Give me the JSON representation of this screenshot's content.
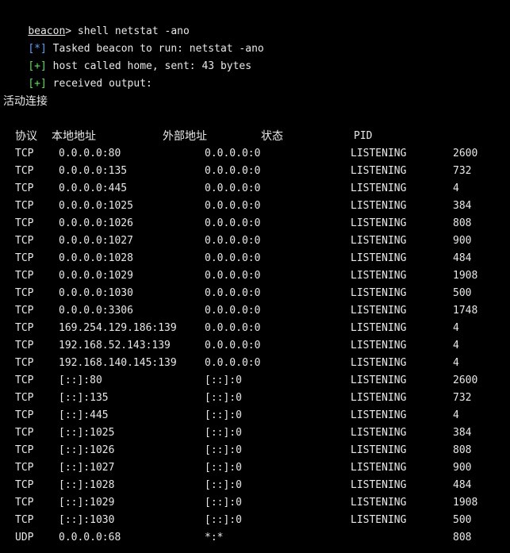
{
  "console": {
    "prompt_name": "beacon",
    "prompt_symbol": ">",
    "command": " shell netstat -ano",
    "messages": [
      {
        "tag": "[*]",
        "text": " Tasked beacon to run: netstat -ano",
        "kind": "info"
      },
      {
        "tag": "[+]",
        "text": " host called home, sent: 43 bytes",
        "kind": "ok"
      },
      {
        "tag": "[+]",
        "text": " received output:",
        "kind": "ok"
      }
    ],
    "colors": {
      "background": "#000000",
      "text": "#e8e8e8",
      "info_tag": "#57a5ff",
      "ok_tag": "#59e359"
    }
  },
  "netstat": {
    "title": "活动连接",
    "headers": {
      "proto": "协议",
      "local": "本地地址",
      "foreign": "外部地址",
      "state": "状态",
      "pid": "PID"
    },
    "rows": [
      [
        "TCP",
        "0.0.0.0:80",
        "0.0.0.0:0",
        "LISTENING",
        "2600"
      ],
      [
        "TCP",
        "0.0.0.0:135",
        "0.0.0.0:0",
        "LISTENING",
        "732"
      ],
      [
        "TCP",
        "0.0.0.0:445",
        "0.0.0.0:0",
        "LISTENING",
        "4"
      ],
      [
        "TCP",
        "0.0.0.0:1025",
        "0.0.0.0:0",
        "LISTENING",
        "384"
      ],
      [
        "TCP",
        "0.0.0.0:1026",
        "0.0.0.0:0",
        "LISTENING",
        "808"
      ],
      [
        "TCP",
        "0.0.0.0:1027",
        "0.0.0.0:0",
        "LISTENING",
        "900"
      ],
      [
        "TCP",
        "0.0.0.0:1028",
        "0.0.0.0:0",
        "LISTENING",
        "484"
      ],
      [
        "TCP",
        "0.0.0.0:1029",
        "0.0.0.0:0",
        "LISTENING",
        "1908"
      ],
      [
        "TCP",
        "0.0.0.0:1030",
        "0.0.0.0:0",
        "LISTENING",
        "500"
      ],
      [
        "TCP",
        "0.0.0.0:3306",
        "0.0.0.0:0",
        "LISTENING",
        "1748"
      ],
      [
        "TCP",
        "169.254.129.186:139",
        "0.0.0.0:0",
        "LISTENING",
        "4"
      ],
      [
        "TCP",
        "192.168.52.143:139",
        "0.0.0.0:0",
        "LISTENING",
        "4"
      ],
      [
        "TCP",
        "192.168.140.145:139",
        "0.0.0.0:0",
        "LISTENING",
        "4"
      ],
      [
        "TCP",
        "[::]:80",
        "[::]:0",
        "LISTENING",
        "2600"
      ],
      [
        "TCP",
        "[::]:135",
        "[::]:0",
        "LISTENING",
        "732"
      ],
      [
        "TCP",
        "[::]:445",
        "[::]:0",
        "LISTENING",
        "4"
      ],
      [
        "TCP",
        "[::]:1025",
        "[::]:0",
        "LISTENING",
        "384"
      ],
      [
        "TCP",
        "[::]:1026",
        "[::]:0",
        "LISTENING",
        "808"
      ],
      [
        "TCP",
        "[::]:1027",
        "[::]:0",
        "LISTENING",
        "900"
      ],
      [
        "TCP",
        "[::]:1028",
        "[::]:0",
        "LISTENING",
        "484"
      ],
      [
        "TCP",
        "[::]:1029",
        "[::]:0",
        "LISTENING",
        "1908"
      ],
      [
        "TCP",
        "[::]:1030",
        "[::]:0",
        "LISTENING",
        "500"
      ],
      [
        "UDP",
        "0.0.0.0:68",
        "*:*",
        "",
        "808"
      ]
    ]
  }
}
